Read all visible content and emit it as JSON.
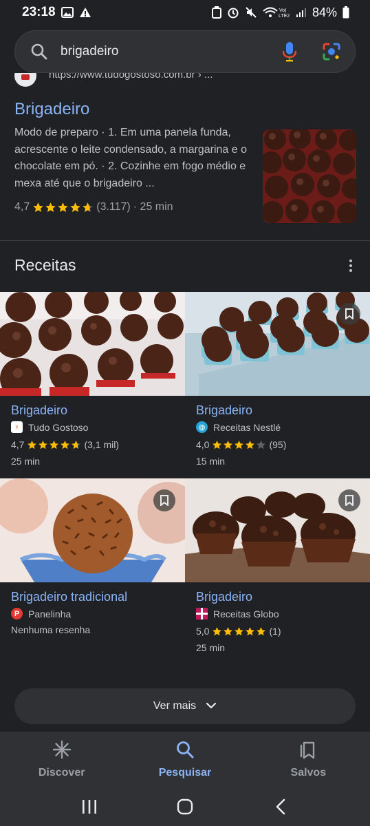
{
  "status_bar": {
    "time": "23:18",
    "battery": "84%"
  },
  "search": {
    "query": "brigadeiro"
  },
  "top_result": {
    "url": "https://www.tudogostoso.com.br › ...",
    "title": "Brigadeiro",
    "snippet": "Modo de preparo · 1. Em uma panela funda, acrescente o leite condensado, a margarina e o chocolate em pó. · 2. Cozinhe em fogo médio e mexa até que o brigadeiro ...",
    "rating": "4,7",
    "stars_value": 4.7,
    "reviews": "(3.117)",
    "time": "· 25 min"
  },
  "recipes": {
    "section_title": "Receitas",
    "cards": [
      {
        "title": "Brigadeiro",
        "source": "Tudo Gostoso",
        "rating": "4,7",
        "stars_value": 4.7,
        "reviews": "(3,1 mil)",
        "time": "25 min"
      },
      {
        "title": "Brigadeiro",
        "source": "Receitas Nestlé",
        "rating": "4,0",
        "stars_value": 4.0,
        "reviews": "(95)",
        "time": "15 min"
      },
      {
        "title": "Brigadeiro tradicional",
        "source": "Panelinha",
        "review_text": "Nenhuma resenha"
      },
      {
        "title": "Brigadeiro",
        "source": "Receitas Globo",
        "rating": "5,0",
        "stars_value": 5.0,
        "reviews": "(1)",
        "time": "25 min"
      }
    ],
    "more_label": "Ver mais"
  },
  "bottom_nav": {
    "discover": "Discover",
    "search": "Pesquisar",
    "saved": "Salvos"
  },
  "colors": {
    "link": "#8ab4f8",
    "background": "#202124",
    "surface": "#303134",
    "star": "#fbbc04"
  },
  "icons": [
    "image-icon",
    "warning-icon",
    "recycle-icon",
    "alarm-icon",
    "mute-icon",
    "wifi-icon",
    "signal-icon",
    "battery-icon",
    "search-icon",
    "mic-icon",
    "lens-icon",
    "more-vert-icon",
    "bookmark-icon",
    "chevron-down-icon",
    "discover-icon",
    "saved-icon",
    "recent-apps-icon",
    "home-icon",
    "back-icon"
  ]
}
